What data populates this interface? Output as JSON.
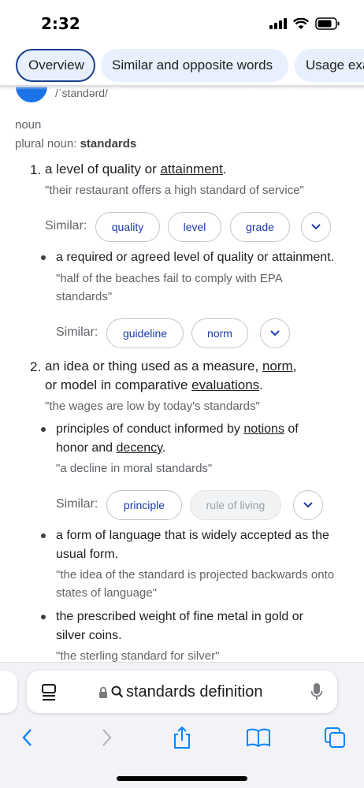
{
  "status": {
    "time": "2:32"
  },
  "tabs": [
    {
      "label": "Overview"
    },
    {
      "label": "Similar and opposite words"
    },
    {
      "label": "Usage examples"
    }
  ],
  "entry": {
    "phonetic": "/ˈstandərd/",
    "part_of_speech": "noun",
    "plural_label": "plural noun: ",
    "plural_value": "standards",
    "similar_label": "Similar:",
    "senses": [
      {
        "number": "1.",
        "def_a": "a level of quality or ",
        "def_link": "attainment",
        "def_end": ".",
        "example": "\"their restaurant offers a high standard of service\"",
        "similar": [
          "quality",
          "level",
          "grade"
        ],
        "subsenses": [
          {
            "def": "a required or agreed level of quality or attainment.",
            "example": "\"half of the beaches fail to comply with EPA standards\"",
            "similar": [
              "guideline",
              "norm"
            ]
          }
        ]
      },
      {
        "number": "2.",
        "def_a": "an idea or thing used as a measure, ",
        "def_link1": "norm",
        "def_b": ",",
        "def_c": "or model in comparative ",
        "def_link2": "evaluations",
        "def_end": ".",
        "example": "\"the wages are low by today's standards\"",
        "subsenses": [
          {
            "def_a": "principles of conduct informed by ",
            "def_link1": "notions",
            "def_b": " of",
            "def_c": "honor and ",
            "def_link2": "decency",
            "def_end": ".",
            "example": "\"a decline in moral standards\"",
            "similar": [
              "principle",
              "rule of living"
            ]
          },
          {
            "def": "a form of language that is widely accepted as the usual form.",
            "example": "\"the idea of the standard is projected backwards onto states of language\""
          },
          {
            "def": "the prescribed weight of fine metal in gold or silver coins.",
            "example": "\"the sterling standard for silver\""
          }
        ]
      }
    ]
  },
  "browser": {
    "url": "standards definition"
  },
  "icons": [
    "signal-icon",
    "wifi-icon",
    "battery-icon",
    "speaker-icon",
    "chevron-down-icon",
    "tab-overview-icon",
    "lock-icon",
    "search-icon",
    "microphone-icon",
    "back-icon",
    "forward-icon",
    "share-icon",
    "bookmarks-icon",
    "tabs-icon"
  ],
  "colors": {
    "accent": "#1a73e8",
    "chip_text": "#1a3aa8",
    "tab_bg": "#e8f0fe"
  }
}
